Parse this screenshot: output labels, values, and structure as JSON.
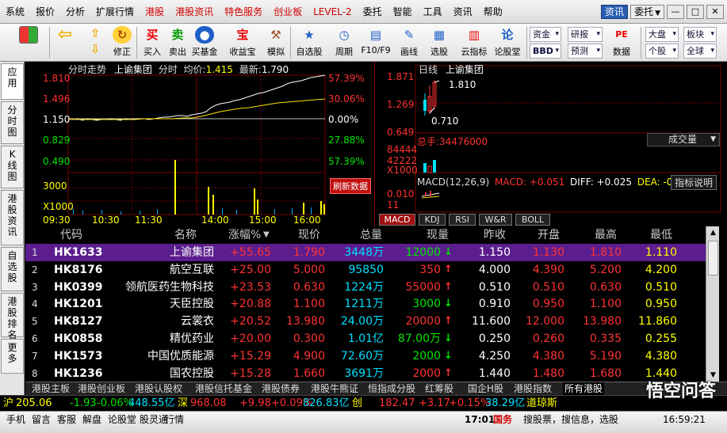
{
  "menu": {
    "items": [
      {
        "label": "系统",
        "red": false
      },
      {
        "label": "报价",
        "red": false
      },
      {
        "label": "分析",
        "red": false
      },
      {
        "label": "扩展行情",
        "red": false
      },
      {
        "label": "港股",
        "red": true
      },
      {
        "label": "港股资讯",
        "red": true
      },
      {
        "label": "特色服务",
        "red": true
      },
      {
        "label": "创业板",
        "red": true
      },
      {
        "label": "LEVEL-2",
        "red": true
      },
      {
        "label": "委托",
        "red": false
      },
      {
        "label": "智能",
        "red": false
      },
      {
        "label": "工具",
        "red": false
      },
      {
        "label": "资讯",
        "red": false
      },
      {
        "label": "帮助",
        "red": false
      }
    ],
    "info_label": "资讯",
    "trade_label": "委托",
    "win_min": "—",
    "win_max": "□",
    "win_close": "✕"
  },
  "toolbar": {
    "modify": "修正",
    "buy": "买入",
    "sell": "卖出",
    "fund": "买基金",
    "yield": "收益宝",
    "sim": "模拟",
    "self": "自选股",
    "period": "周期",
    "f10": "F10/F9",
    "draw": "画线",
    "pick": "选股",
    "cloud": "云指标",
    "forum": "论股堂",
    "funds_dd": "资金",
    "research_dd": "研报",
    "forecast_dd": "预测",
    "bbd": "BBD",
    "data": "数据",
    "dapan": "大盘",
    "sector": "板块",
    "stock_dd": "个股",
    "global_dd": "全球"
  },
  "left_tabs": [
    "应用",
    "分时图",
    "K线图",
    "港股资讯",
    "自选股",
    "港股排名",
    "更多"
  ],
  "intraday": {
    "title": "分时走势",
    "stock": "上谕集团",
    "mode": "分时",
    "avg_label": "均价:",
    "avg": "1.415",
    "latest_label": "最新:",
    "latest": "1.790",
    "yticks": [
      "1.810",
      "1.496",
      "1.150",
      "0.829",
      "0.490"
    ],
    "pticks": [
      "57.39%",
      "30.06%",
      "0.00%",
      "27.88%",
      "57.39%"
    ],
    "vol_ticks": [
      "3000",
      "X1000"
    ],
    "xticks": [
      "09:30",
      "10:30",
      "11:30",
      "14:00",
      "15:00",
      "16:00"
    ],
    "refresh": "刷新数据"
  },
  "daily": {
    "title": "日线",
    "stock": "上谕集团",
    "yticks": [
      "1.871",
      "1.269",
      "0.649"
    ],
    "hi": "1.810",
    "lo": "0.710",
    "vol_label": "总手:",
    "vol_value": "34476000",
    "vol_dd": "成交量",
    "vol_ticks": [
      "84444",
      "42222",
      "X1000"
    ],
    "macd_title": "MACD(12,26,9)",
    "macd_val": "MACD: +0.051",
    "diff": "DIFF: +0.025",
    "dea": "DEA: -0",
    "macd_ticks": [
      "0.010",
      "11"
    ],
    "indicator_btn": "指标说明",
    "tabs": [
      "MACD",
      "KDJ",
      "RSI",
      "W&R",
      "BOLL"
    ]
  },
  "table": {
    "headers": {
      "code": "代码",
      "name": "名称",
      "chg": "涨幅%",
      "price": "现价",
      "vol": "总量",
      "cur": "现量",
      "prev": "昨收",
      "open": "开盘",
      "high": "最高",
      "low": "最低"
    },
    "rows": [
      {
        "idx": "1",
        "code": "HK1633",
        "name": "上谕集团",
        "chg": "+55.65",
        "price": "1.790",
        "vol": "3448万",
        "cur": "12000",
        "dir": "down",
        "prev": "1.150",
        "open": "1.130",
        "high": "1.810",
        "low": "1.110"
      },
      {
        "idx": "2",
        "code": "HK8176",
        "name": "航空互联",
        "chg": "+25.00",
        "price": "5.000",
        "vol": "95850",
        "cur": "350",
        "dir": "up",
        "prev": "4.000",
        "open": "4.390",
        "high": "5.200",
        "low": "4.200"
      },
      {
        "idx": "3",
        "code": "HK0399",
        "name": "领航医药生物科技",
        "chg": "+23.53",
        "price": "0.630",
        "vol": "1224万",
        "cur": "55000",
        "dir": "up",
        "prev": "0.510",
        "open": "0.510",
        "high": "0.630",
        "low": "0.510"
      },
      {
        "idx": "4",
        "code": "HK1201",
        "name": "天臣控股",
        "chg": "+20.88",
        "price": "1.100",
        "vol": "1211万",
        "cur": "3000",
        "dir": "down",
        "prev": "0.910",
        "open": "0.950",
        "high": "1.100",
        "low": "0.950"
      },
      {
        "idx": "5",
        "code": "HK8127",
        "name": "云裳衣",
        "chg": "+20.52",
        "price": "13.980",
        "vol": "24.00万",
        "cur": "20000",
        "dir": "up",
        "prev": "11.600",
        "open": "12.000",
        "high": "13.980",
        "low": "11.860"
      },
      {
        "idx": "6",
        "code": "HK0858",
        "name": "精优药业",
        "chg": "+20.00",
        "price": "0.300",
        "vol": "1.01亿",
        "cur": "87.00万",
        "dir": "down",
        "prev": "0.250",
        "open": "0.260",
        "high": "0.335",
        "low": "0.255"
      },
      {
        "idx": "7",
        "code": "HK1573",
        "name": "中国优质能源",
        "chg": "+15.29",
        "price": "4.900",
        "vol": "72.60万",
        "cur": "2000",
        "dir": "down",
        "prev": "4.250",
        "open": "4.380",
        "high": "5.190",
        "low": "4.380"
      },
      {
        "idx": "8",
        "code": "HK1236",
        "name": "国农控股",
        "chg": "+15.28",
        "price": "1.660",
        "vol": "3691万",
        "cur": "2000",
        "dir": "up",
        "prev": "1.440",
        "open": "1.480",
        "high": "1.680",
        "low": "1.440"
      }
    ]
  },
  "sheets": [
    "港股主板",
    "港股创业板",
    "港股认股权",
    "港股信托基金",
    "港股债券",
    "港股牛熊证",
    "恒指成分股",
    "红筹股",
    "国企H股",
    "港股指数",
    "所有港股"
  ],
  "ticker": {
    "sh_label": "沪",
    "sh_val": "205.06",
    "sh_chg": "-1.93",
    "sh_pct": "-0.06%",
    "sh_amt": "448.55亿",
    "sz_label": "深",
    "sz_val": "968.08",
    "sz_chg": "+9.98",
    "sz_pct": "+0.09%",
    "sz_amt": "826.83亿",
    "cy_label": "创",
    "cy_val": "182.47",
    "cy_chg": "+3.17",
    "cy_pct": "+0.15%",
    "cy_amt": "38.29亿",
    "dj": "道琼斯"
  },
  "status": {
    "items": [
      "手机",
      "留言",
      "客服",
      "解盘",
      "论股堂",
      "股灵通",
      "行情"
    ],
    "time": "17:01",
    "broker": "国务",
    "search": "搜股票，搜信息，选股",
    "clock": "16:59:21"
  },
  "watermark": "悟空问答"
}
